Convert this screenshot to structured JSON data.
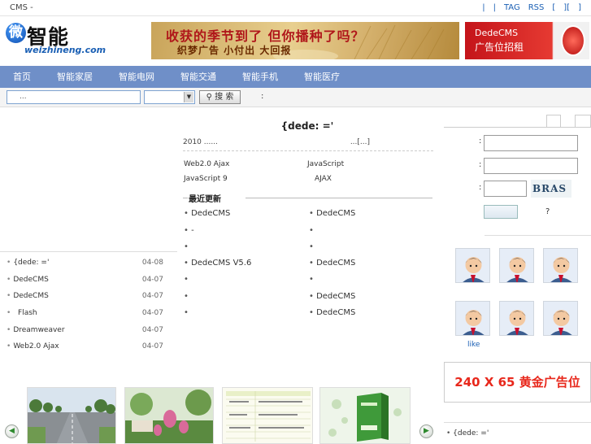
{
  "topbar": {
    "site": "CMS -",
    "links": [
      "|",
      "|",
      "TAG",
      "RSS",
      "[",
      "][",
      "]"
    ]
  },
  "logo": {
    "glyph": "微",
    "name": "智能",
    "domain": "weizhineng.com"
  },
  "banner_main": {
    "line1": "收获的季节到了 但你播种了吗？",
    "line2": "织梦广告  小付出  大回报"
  },
  "banner_side": {
    "line1": "DedeCMS",
    "line2": "广告位招租"
  },
  "nav": {
    "items": [
      "首页",
      "智能家居",
      "智能电网",
      "智能交通",
      "智能手机",
      "智能医疗"
    ]
  },
  "search": {
    "placeholder": "...",
    "button": "搜 索",
    "hint": ":"
  },
  "headline": {
    "title": "{dede:        ='",
    "summary": "2010         ......",
    "more": "...[...]"
  },
  "featured": [
    {
      "left": "Web2.0  Ajax",
      "right": "JavaScript"
    },
    {
      "left": "JavaScript 9",
      "right": "AJAX"
    }
  ],
  "latest": {
    "title": "最近更新",
    "left": [
      "DedeCMS",
      "-",
      "",
      "DedeCMS V5.6",
      "",
      "",
      ""
    ],
    "right": [
      "DedeCMS",
      "",
      "",
      "DedeCMS",
      "",
      "DedeCMS",
      "DedeCMS"
    ]
  },
  "left_list": [
    {
      "title": "{dede:       ='",
      "date": "04-08"
    },
    {
      "title": "DedeCMS",
      "date": "04-07"
    },
    {
      "title": "DedeCMS",
      "date": "04-07"
    },
    {
      "title": "  Flash",
      "date": "04-07"
    },
    {
      "title": "Dreamweaver",
      "date": "04-07"
    },
    {
      "title": "Web2.0  Ajax",
      "date": "04-07"
    }
  ],
  "login": {
    "label1": ":",
    "label2": ":",
    "label3": ":",
    "captcha": "BRAS",
    "forgot": "?"
  },
  "members": {
    "like": "like"
  },
  "ad": {
    "text": "240 X 65 黄金广告位"
  },
  "bottom_right": {
    "item": "{dede:       ='"
  },
  "arrows": {
    "prev": "◀",
    "next": "▶"
  }
}
